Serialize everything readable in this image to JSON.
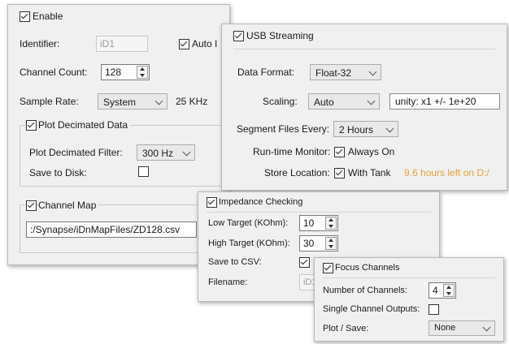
{
  "main_panel": {
    "enable_label": "Enable",
    "enable_checked": true,
    "identifier_label": "Identifier:",
    "identifier_value": "iD1",
    "auto_label": "Auto I",
    "auto_checked": true,
    "channel_count_label": "Channel Count:",
    "channel_count_value": "128",
    "sample_rate_label": "Sample Rate:",
    "sample_rate_value": "System",
    "sample_rate_freq": "25 KHz",
    "plot_decimated_label": "Plot Decimated Data",
    "plot_decimated_checked": true,
    "plot_filter_label": "Plot Decimated Filter:",
    "plot_filter_value": "300 Hz",
    "save_to_disk_label": "Save to Disk:",
    "save_to_disk_checked": false,
    "channel_map_label": "Channel Map",
    "channel_map_checked": true,
    "channel_map_path": ":/Synapse/iDnMapFiles/ZD128.csv"
  },
  "usb_panel": {
    "title": "USB Streaming",
    "checked": true,
    "data_format_label": "Data Format:",
    "data_format_value": "Float-32",
    "scaling_label": "Scaling:",
    "scaling_value": "Auto",
    "unity_text": "unity:  x1   +/-  1e+20",
    "segment_label": "Segment Files Every:",
    "segment_value": "2 Hours",
    "runtime_label": "Run-time Monitor:",
    "runtime_option": "Always On",
    "runtime_checked": true,
    "store_label": "Store Location:",
    "store_option": "With Tank",
    "store_checked": true,
    "store_warning": "9.6 hours left on D:/",
    "warning_color": "#e2a33a"
  },
  "impedance_panel": {
    "title": "Impedance Checking",
    "checked": true,
    "low_label": "Low Target (KOhm):",
    "low_value": "10",
    "high_label": "High Target (KOhm):",
    "high_value": "30",
    "save_csv_label": "Save to CSV:",
    "save_csv_checked": true,
    "filename_label": "Filename:",
    "filename_value": "iD1"
  },
  "focus_panel": {
    "title": "Focus Channels",
    "checked": true,
    "num_channels_label": "Number of Channels:",
    "num_channels_value": "4",
    "single_outputs_label": "Single Channel Outputs:",
    "single_outputs_checked": false,
    "plot_save_label": "Plot / Save:",
    "plot_save_value": "None"
  }
}
